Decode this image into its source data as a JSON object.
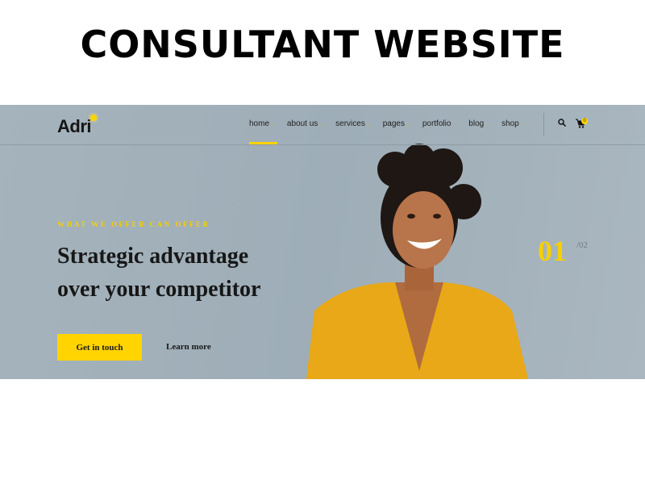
{
  "banner": {
    "title": "CONSULTANT WEBSITE"
  },
  "header": {
    "logo": "Adri",
    "nav": [
      {
        "label": "home",
        "active": true
      },
      {
        "label": "about us"
      },
      {
        "label": "services"
      },
      {
        "label": "pages"
      },
      {
        "label": "portfolio"
      },
      {
        "label": "blog"
      },
      {
        "label": "shop"
      }
    ],
    "cart_count": "0"
  },
  "hero": {
    "kicker": "WHAT WE OFFER CAN OFFER",
    "headline_line1": "Strategic advantage",
    "headline_line2": "over your competitor",
    "primary_button": "Get in touch",
    "secondary_link": "Learn more",
    "slide_current": "01",
    "slide_total": "/02"
  },
  "colors": {
    "accent": "#ffd400",
    "text": "#171717",
    "hero_bg": "#a5b3bc"
  }
}
